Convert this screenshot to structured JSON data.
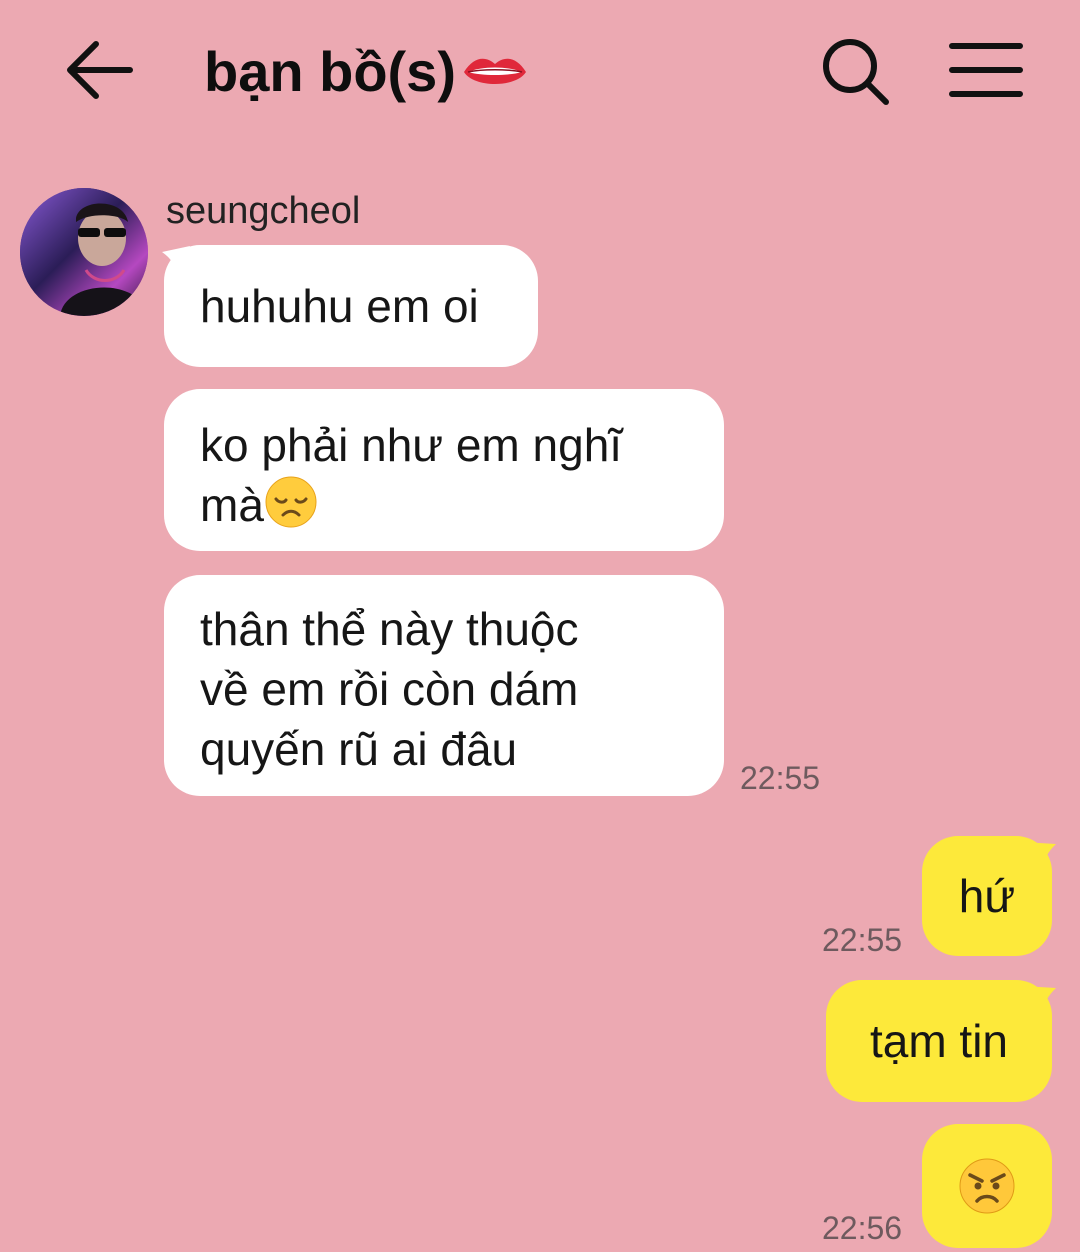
{
  "header": {
    "title": "bạn bồ(s)",
    "back_icon": "arrow-left-icon",
    "title_emoji": "lips-emoji",
    "search_icon": "search-icon",
    "menu_icon": "hamburger-menu-icon"
  },
  "colors": {
    "background": "#eca9b2",
    "incoming_bubble": "#ffffff",
    "outgoing_bubble": "#fde93a",
    "timestamp": "#6e5a5e"
  },
  "messages": {
    "incoming": {
      "sender": "seungcheol",
      "bubble1": "huhuhu em oi",
      "bubble2_line1": "ko phải như em nghĩ",
      "bubble2_line2": "mà",
      "bubble2_emoji": "disappointed-face-emoji",
      "bubble3_line1": "thân thể này thuộc",
      "bubble3_line2": "về em rồi còn dám",
      "bubble3_line3": "quyến rũ ai đâu",
      "time": "22:55"
    },
    "outgoing": {
      "bubble1": "hứ",
      "time1": "22:55",
      "bubble2": "tạm tin",
      "bubble3_emoji": "angry-face-emoji",
      "time3": "22:56"
    }
  }
}
